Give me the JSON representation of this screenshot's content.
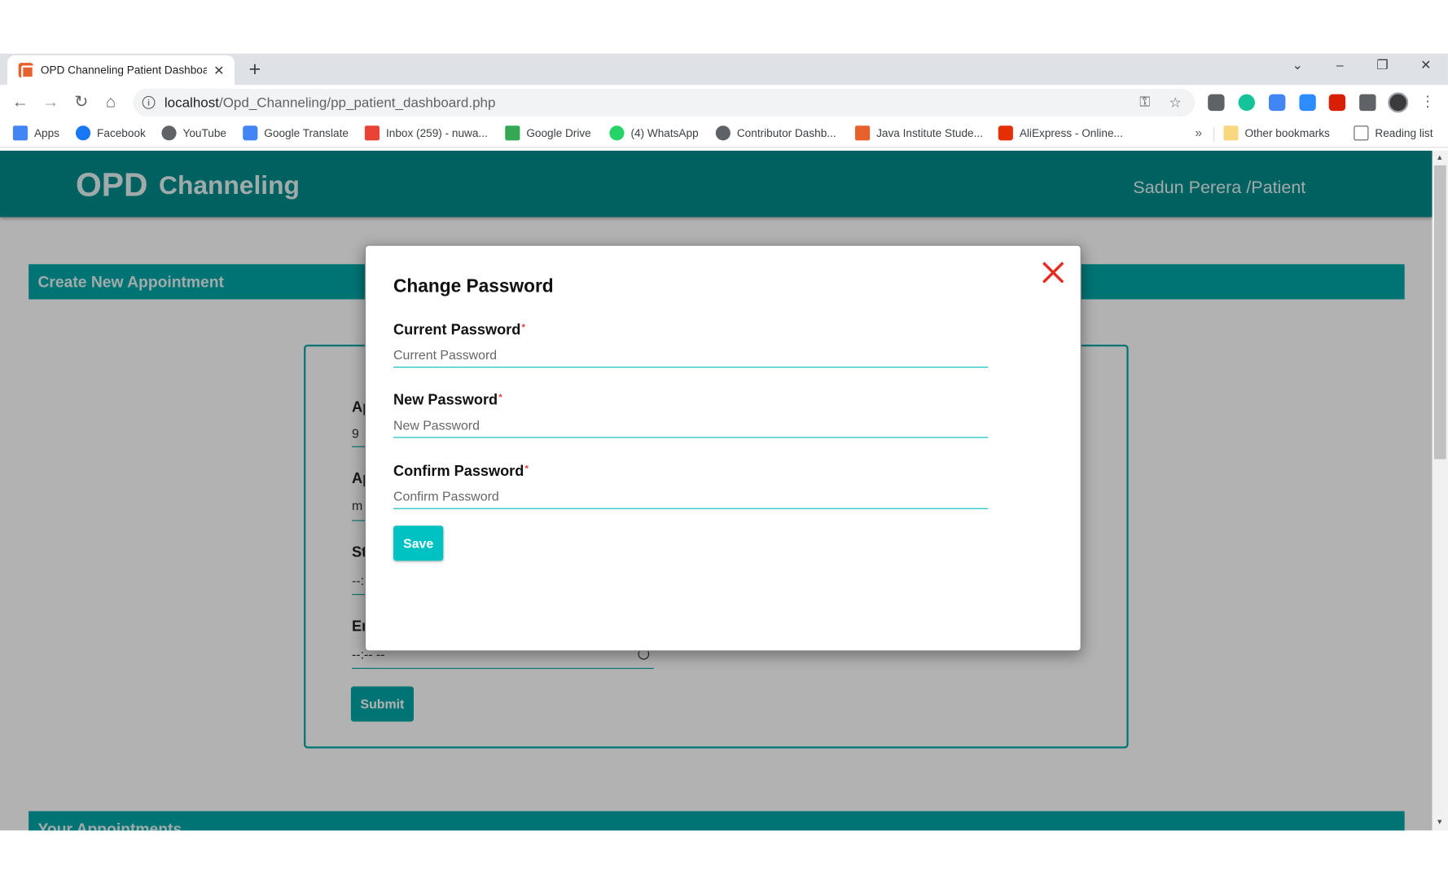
{
  "browser": {
    "tab_title": "OPD Channeling Patient Dashboard",
    "url_host": "localhost",
    "url_path": "/Opd_Channeling/pp_patient_dashboard.php",
    "bookmarks": [
      {
        "label": "Apps",
        "color": "#4285f4"
      },
      {
        "label": "Facebook",
        "color": "#1877f2"
      },
      {
        "label": "YouTube",
        "color": "#5f6368"
      },
      {
        "label": "Google Translate",
        "color": "#4285f4"
      },
      {
        "label": "Inbox (259) - nuwa...",
        "color": "#ea4335"
      },
      {
        "label": "Google Drive",
        "color": "#34a853"
      },
      {
        "label": "(4) WhatsApp",
        "color": "#25d366"
      },
      {
        "label": "Contributor Dashb...",
        "color": "#5f6368"
      },
      {
        "label": "Java Institute Stude...",
        "color": "#e8602c"
      },
      {
        "label": "AliExpress - Online...",
        "color": "#e62e04"
      }
    ],
    "more_label": "»",
    "other_bookmarks": "Other bookmarks",
    "reading_list": "Reading list"
  },
  "app": {
    "brand_main": "OPD",
    "brand_sub": "Channeling",
    "user_label": "Sadun Perera /Patient",
    "accent": "#008b8b"
  },
  "create_section": {
    "title": "Create New Appointment",
    "fields": [
      {
        "label": "Ap",
        "value": "9"
      },
      {
        "label": "Ap",
        "value": "m"
      },
      {
        "label": "St",
        "value": "--:"
      },
      {
        "label": "En",
        "value": "--:-- --"
      }
    ],
    "submit_label": "Submit"
  },
  "appointments_section": {
    "title": "Your Appointments"
  },
  "modal": {
    "title": "Change Password",
    "fields": [
      {
        "label": "Current Password",
        "placeholder": "Current Password"
      },
      {
        "label": "New Password",
        "placeholder": "New Password"
      },
      {
        "label": "Confirm Password",
        "placeholder": "Confirm Password"
      }
    ],
    "required_mark": "*",
    "save_label": "Save",
    "close_color": "#e8291f"
  }
}
